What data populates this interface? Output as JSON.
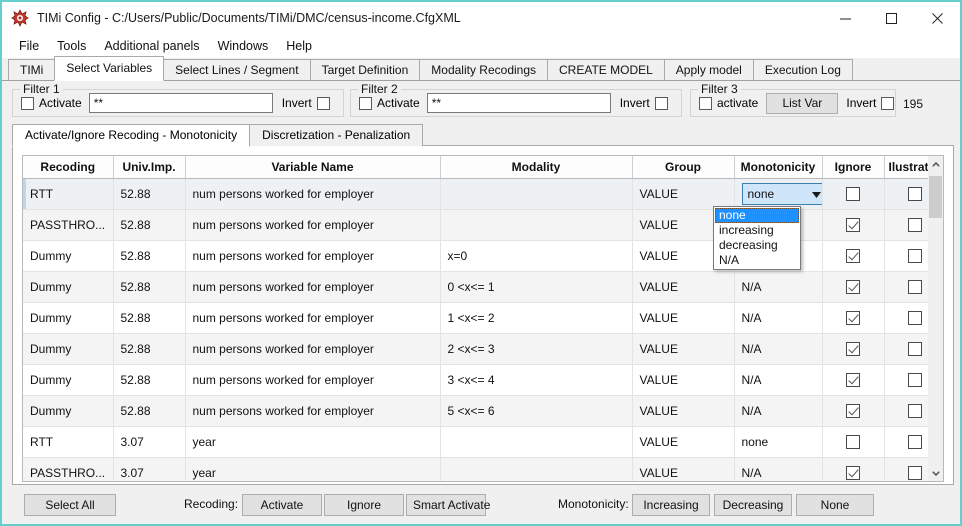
{
  "window": {
    "title": "TIMi Config - C:/Users/Public/Documents/TIMi/DMC/census-income.CfgXML",
    "app_icon": "timi-logo-icon",
    "minimize": "—",
    "maximize": "☐",
    "close": "✕",
    "border_color": "#66cfce"
  },
  "menu": {
    "items": [
      {
        "label": "File"
      },
      {
        "label": "Tools"
      },
      {
        "label": "Additional panels"
      },
      {
        "label": "Windows"
      },
      {
        "label": "Help"
      }
    ]
  },
  "tabs": {
    "active_index": 1,
    "items": [
      {
        "label": "TIMi"
      },
      {
        "label": "Select Variables"
      },
      {
        "label": "Select Lines / Segment"
      },
      {
        "label": "Target Definition"
      },
      {
        "label": "Modality Recodings"
      },
      {
        "label": "CREATE MODEL"
      },
      {
        "label": "Apply model"
      },
      {
        "label": "Execution Log"
      }
    ]
  },
  "filters": {
    "filter1": {
      "legend": "Filter 1",
      "activate_label": "Activate",
      "activate_checked": false,
      "value": "**",
      "placeholder": "",
      "invert_label": "Invert",
      "invert_checked": false
    },
    "filter2": {
      "legend": "Filter 2",
      "activate_label": "Activate",
      "activate_checked": false,
      "value": "**",
      "placeholder": "",
      "invert_label": "Invert",
      "invert_checked": false
    },
    "filter3": {
      "legend": "Filter 3",
      "activate_label": "activate",
      "activate_checked": false,
      "list_var_label": "List Var",
      "invert_label": "Invert",
      "invert_checked": false
    },
    "count": "195"
  },
  "inner_tabs": {
    "active_index": 0,
    "items": [
      {
        "label": "Activate/Ignore Recoding - Monotonicity"
      },
      {
        "label": "Discretization - Penalization"
      }
    ]
  },
  "table": {
    "columns": [
      {
        "key": "recoding",
        "label": "Recoding"
      },
      {
        "key": "univ_imp",
        "label": "Univ.Imp."
      },
      {
        "key": "variable_name",
        "label": "Variable Name"
      },
      {
        "key": "modality",
        "label": "Modality"
      },
      {
        "key": "group",
        "label": "Group"
      },
      {
        "key": "monotonicity",
        "label": "Monotonicity"
      },
      {
        "key": "ignore",
        "label": "Ignore"
      },
      {
        "key": "illustrative",
        "label": "Ilustrative"
      }
    ],
    "rows": [
      {
        "recoding": "RTT",
        "univ_imp": "52.88",
        "variable_name": "num persons worked for employer",
        "modality": "",
        "group": "VALUE",
        "monotonicity": "none",
        "monotonicity_is_combo": true,
        "ignore": false,
        "illustrative": false,
        "selected": true
      },
      {
        "recoding": "PASSTHRO...",
        "univ_imp": "52.88",
        "variable_name": "num persons worked for employer",
        "modality": "",
        "group": "VALUE",
        "monotonicity": "N/A",
        "monotonicity_is_combo": false,
        "ignore": true,
        "illustrative": false,
        "selected": false
      },
      {
        "recoding": "Dummy",
        "univ_imp": "52.88",
        "variable_name": "num persons worked for employer",
        "modality": "x=0",
        "group": "VALUE",
        "monotonicity": "N/A",
        "monotonicity_is_combo": false,
        "ignore": true,
        "illustrative": false,
        "selected": false
      },
      {
        "recoding": "Dummy",
        "univ_imp": "52.88",
        "variable_name": "num persons worked for employer",
        "modality": "0 <x<= 1",
        "group": "VALUE",
        "monotonicity": "N/A",
        "monotonicity_is_combo": false,
        "ignore": true,
        "illustrative": false,
        "selected": false
      },
      {
        "recoding": "Dummy",
        "univ_imp": "52.88",
        "variable_name": "num persons worked for employer",
        "modality": "1 <x<= 2",
        "group": "VALUE",
        "monotonicity": "N/A",
        "monotonicity_is_combo": false,
        "ignore": true,
        "illustrative": false,
        "selected": false
      },
      {
        "recoding": "Dummy",
        "univ_imp": "52.88",
        "variable_name": "num persons worked for employer",
        "modality": "2 <x<= 3",
        "group": "VALUE",
        "monotonicity": "N/A",
        "monotonicity_is_combo": false,
        "ignore": true,
        "illustrative": false,
        "selected": false
      },
      {
        "recoding": "Dummy",
        "univ_imp": "52.88",
        "variable_name": "num persons worked for employer",
        "modality": "3 <x<= 4",
        "group": "VALUE",
        "monotonicity": "N/A",
        "monotonicity_is_combo": false,
        "ignore": true,
        "illustrative": false,
        "selected": false
      },
      {
        "recoding": "Dummy",
        "univ_imp": "52.88",
        "variable_name": "num persons worked for employer",
        "modality": "5 <x<= 6",
        "group": "VALUE",
        "monotonicity": "N/A",
        "monotonicity_is_combo": false,
        "ignore": true,
        "illustrative": false,
        "selected": false
      },
      {
        "recoding": "RTT",
        "univ_imp": "3.07",
        "variable_name": "year",
        "modality": "",
        "group": "VALUE",
        "monotonicity": "none",
        "monotonicity_is_combo": false,
        "ignore": false,
        "illustrative": false,
        "selected": false
      },
      {
        "recoding": "PASSTHRO...",
        "univ_imp": "3.07",
        "variable_name": "year",
        "modality": "",
        "group": "VALUE",
        "monotonicity": "N/A",
        "monotonicity_is_combo": false,
        "ignore": true,
        "illustrative": false,
        "selected": false
      }
    ]
  },
  "monotonicity_dropdown": {
    "open": true,
    "selected": "none",
    "options": [
      {
        "label": "none",
        "selected": true
      },
      {
        "label": "increasing",
        "selected": false
      },
      {
        "label": "decreasing",
        "selected": false
      },
      {
        "label": "N/A",
        "selected": false
      }
    ]
  },
  "bottom": {
    "select_all_label": "Select All",
    "recoding_label": "Recoding:",
    "activate_label": "Activate",
    "ignore_label": "Ignore",
    "smart_activate_label": "Smart Activate",
    "monotonicity_label": "Monotonicity:",
    "increasing_label": "Increasing",
    "decreasing_label": "Decreasing",
    "none_label": "None"
  },
  "colors": {
    "selection_blue": "#1e90ff",
    "combo_fill": "#cfe6fa",
    "window_border": "#66cfce"
  }
}
